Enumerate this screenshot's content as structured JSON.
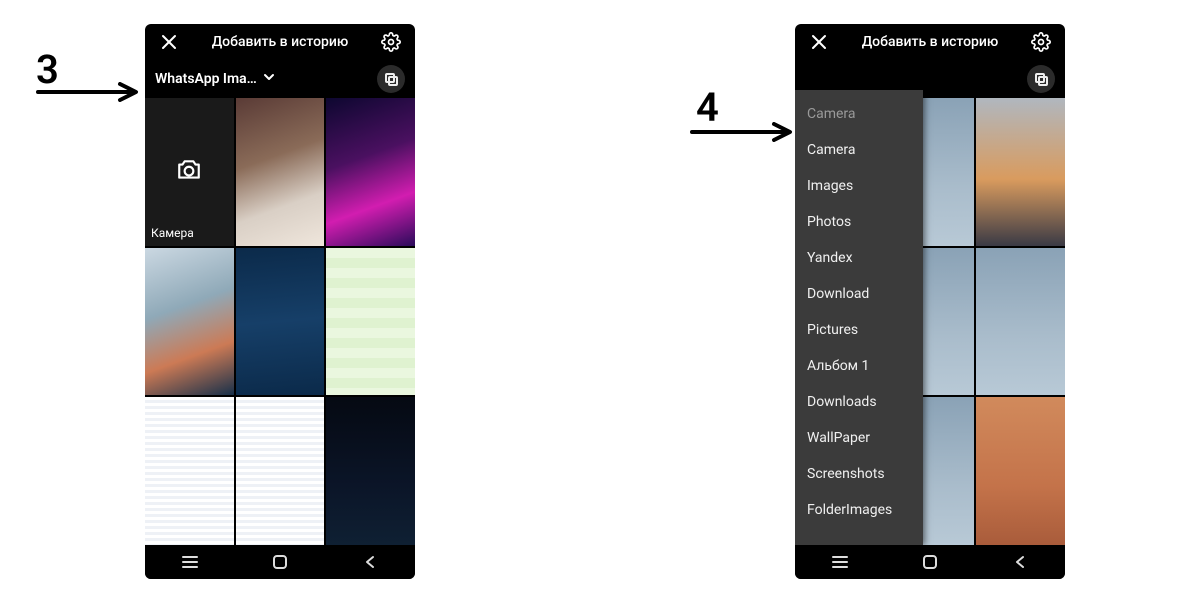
{
  "annotations": {
    "step3": "3",
    "step4": "4"
  },
  "left": {
    "header_title": "Добавить в историю",
    "album_label": "WhatsApp Ima…",
    "camera_tile_label": "Камера"
  },
  "right": {
    "header_title": "Добавить в историю",
    "folders": [
      "Camera",
      "Camera",
      "Images",
      "Photos",
      "Yandex",
      "Download",
      "Pictures",
      "Альбом 1",
      "Downloads",
      "WallPaper",
      "Screenshots",
      "FolderImages"
    ]
  }
}
